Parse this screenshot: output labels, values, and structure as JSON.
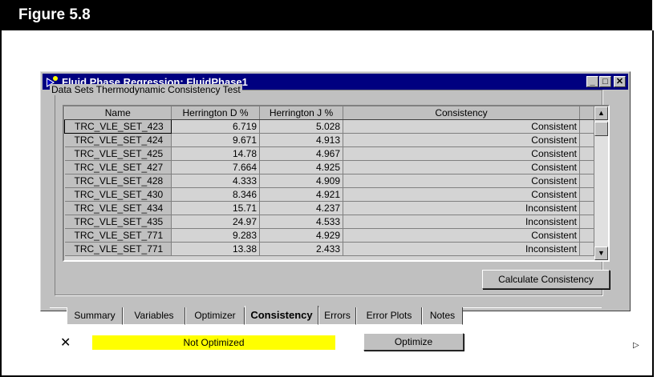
{
  "figure": {
    "label": "Figure 5.8"
  },
  "window": {
    "title": "Fluid Phase Regression:  FluidPhase1",
    "icon": "fluid-phase-app-icon",
    "buttons": [
      "minimize",
      "maximize",
      "close"
    ]
  },
  "group": {
    "label": "Data Sets Thermodynamic Consistency Test"
  },
  "grid": {
    "columns": [
      "Name",
      "Herrington D %",
      "Herrington J %",
      "Consistency"
    ],
    "rows": [
      [
        "TRC_VLE_SET_423",
        "6.719",
        "5.028",
        "Consistent"
      ],
      [
        "TRC_VLE_SET_424",
        "9.671",
        "4.913",
        "Consistent"
      ],
      [
        "TRC_VLE_SET_425",
        "14.78",
        "4.967",
        "Consistent"
      ],
      [
        "TRC_VLE_SET_427",
        "7.664",
        "4.925",
        "Consistent"
      ],
      [
        "TRC_VLE_SET_428",
        "4.333",
        "4.909",
        "Consistent"
      ],
      [
        "TRC_VLE_SET_430",
        "8.346",
        "4.921",
        "Consistent"
      ],
      [
        "TRC_VLE_SET_434",
        "15.71",
        "4.237",
        "Inconsistent"
      ],
      [
        "TRC_VLE_SET_435",
        "24.97",
        "4.533",
        "Inconsistent"
      ],
      [
        "TRC_VLE_SET_771",
        "9.283",
        "4.929",
        "Consistent"
      ],
      [
        "TRC_VLE_SET_771",
        "13.38",
        "2.433",
        "Inconsistent"
      ]
    ]
  },
  "buttons": {
    "calculate": "Calculate Consistency",
    "optimize": "Optimize"
  },
  "tabs": [
    {
      "label": "Summary",
      "active": false
    },
    {
      "label": "Variables",
      "active": false
    },
    {
      "label": "Optimizer",
      "active": false
    },
    {
      "label": "Consistency",
      "active": true
    },
    {
      "label": "Errors",
      "active": false
    },
    {
      "label": "Error Plots",
      "active": false
    },
    {
      "label": "Notes",
      "active": false
    }
  ],
  "status": {
    "text": "Not Optimized",
    "color": "#ffff00"
  },
  "colors": {
    "titlebar": "#000080",
    "window_bg": "#c0c0c0",
    "status_bg": "#ffff00"
  }
}
